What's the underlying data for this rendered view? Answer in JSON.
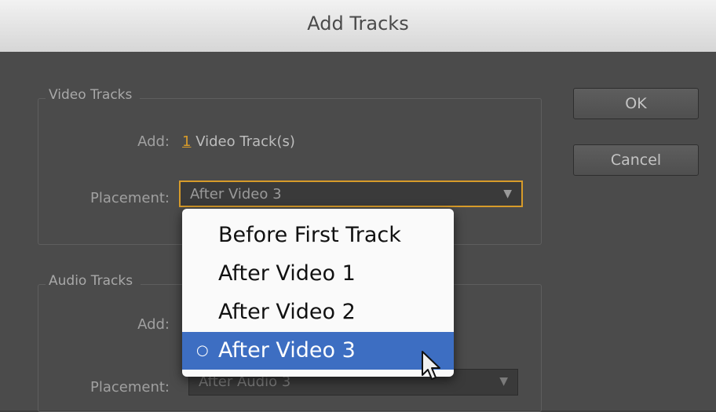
{
  "window": {
    "title": "Add Tracks"
  },
  "buttons": {
    "ok": "OK",
    "cancel": "Cancel"
  },
  "video": {
    "section_label": "Video Tracks",
    "add_label": "Add:",
    "add_count": "1",
    "add_suffix": "Video Track(s)",
    "placement_label": "Placement:",
    "placement_value": "After Video 3"
  },
  "audio": {
    "section_label": "Audio Tracks",
    "add_label": "Add:",
    "placement_label": "Placement:",
    "placement_value": "After Audio 3"
  },
  "dropdown": {
    "options": [
      "Before First Track",
      "After Video 1",
      "After Video 2",
      "After Video 3"
    ],
    "selected": "After Video 3"
  },
  "icons": {
    "chevron": "chevron-down-icon",
    "cursor": "mouse-pointer-icon",
    "selected_mark": "radio-dot-icon"
  },
  "colors": {
    "accent": "#d79b2a",
    "selection": "#3d6ec2",
    "background": "#4b4b4b"
  }
}
